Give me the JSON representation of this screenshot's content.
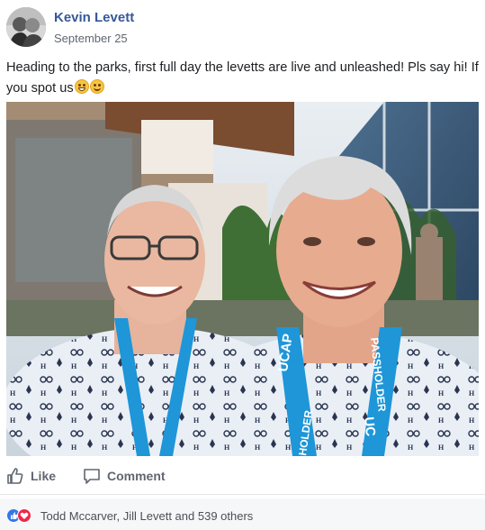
{
  "post": {
    "author": "Kevin Levett",
    "date": "September 25",
    "text": "Heading to the parks, first full day the levetts are live and unleashed! Pls say hi! If you spot us",
    "emojis": [
      "grinning-squinting-face",
      "slightly-smiling-face"
    ]
  },
  "photo": {
    "lanyard_left": "UCAP",
    "lanyard_right": "PASSHOLDER",
    "lanyard_bottom_a": "HOLDER",
    "lanyard_bottom_b": "UC"
  },
  "actions": {
    "like_label": "Like",
    "comment_label": "Comment"
  },
  "reactions": {
    "text": "Todd Mccarver, Jill Levett and 539 others",
    "icons": [
      "like-reaction-icon",
      "love-reaction-icon"
    ],
    "colors": {
      "like": "#3578e5",
      "love": "#f0284a"
    }
  },
  "colors": {
    "author_link": "#365899",
    "action_text": "#606770",
    "lanyard": "#1e96d8"
  }
}
